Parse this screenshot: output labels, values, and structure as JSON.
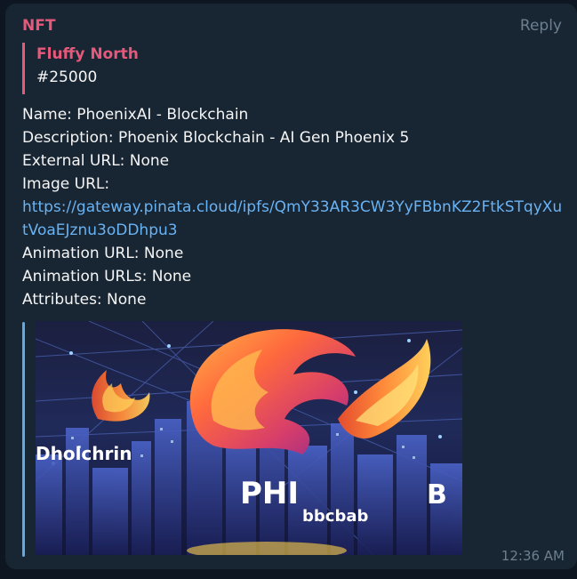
{
  "message": {
    "sender": "NFT",
    "reply_label": "Reply",
    "quote": {
      "author": "Fluffy North",
      "text": "#25000"
    },
    "lines": {
      "name": "Name: PhoenixAI - Blockchain",
      "description": "Description: Phoenix Blockchain - AI Gen Phoenix 5",
      "external_url": "External URL: None",
      "image_url_label": "Image URL:",
      "image_url": "https://gateway.pinata.cloud/ipfs/QmY33AR3CW3YyFBbnKZ2FtkSTqyXutVoaEJznu3oDDhpu3",
      "animation_url": "Animation URL: None",
      "animation_urls": "Animation URLs: None",
      "attributes": "Attributes: None"
    },
    "image_text": {
      "left": "Dholchrin",
      "center": "PHI",
      "center_sub": "bbcbab",
      "right": "B"
    },
    "time": "12:36 AM"
  },
  "colors": {
    "background": "#0e1621",
    "bubble": "#182533",
    "accent_pink": "#e6597a",
    "link": "#6ab3f3",
    "preview_bar": "#5fa9e6",
    "meta": "#6d7f8f"
  }
}
